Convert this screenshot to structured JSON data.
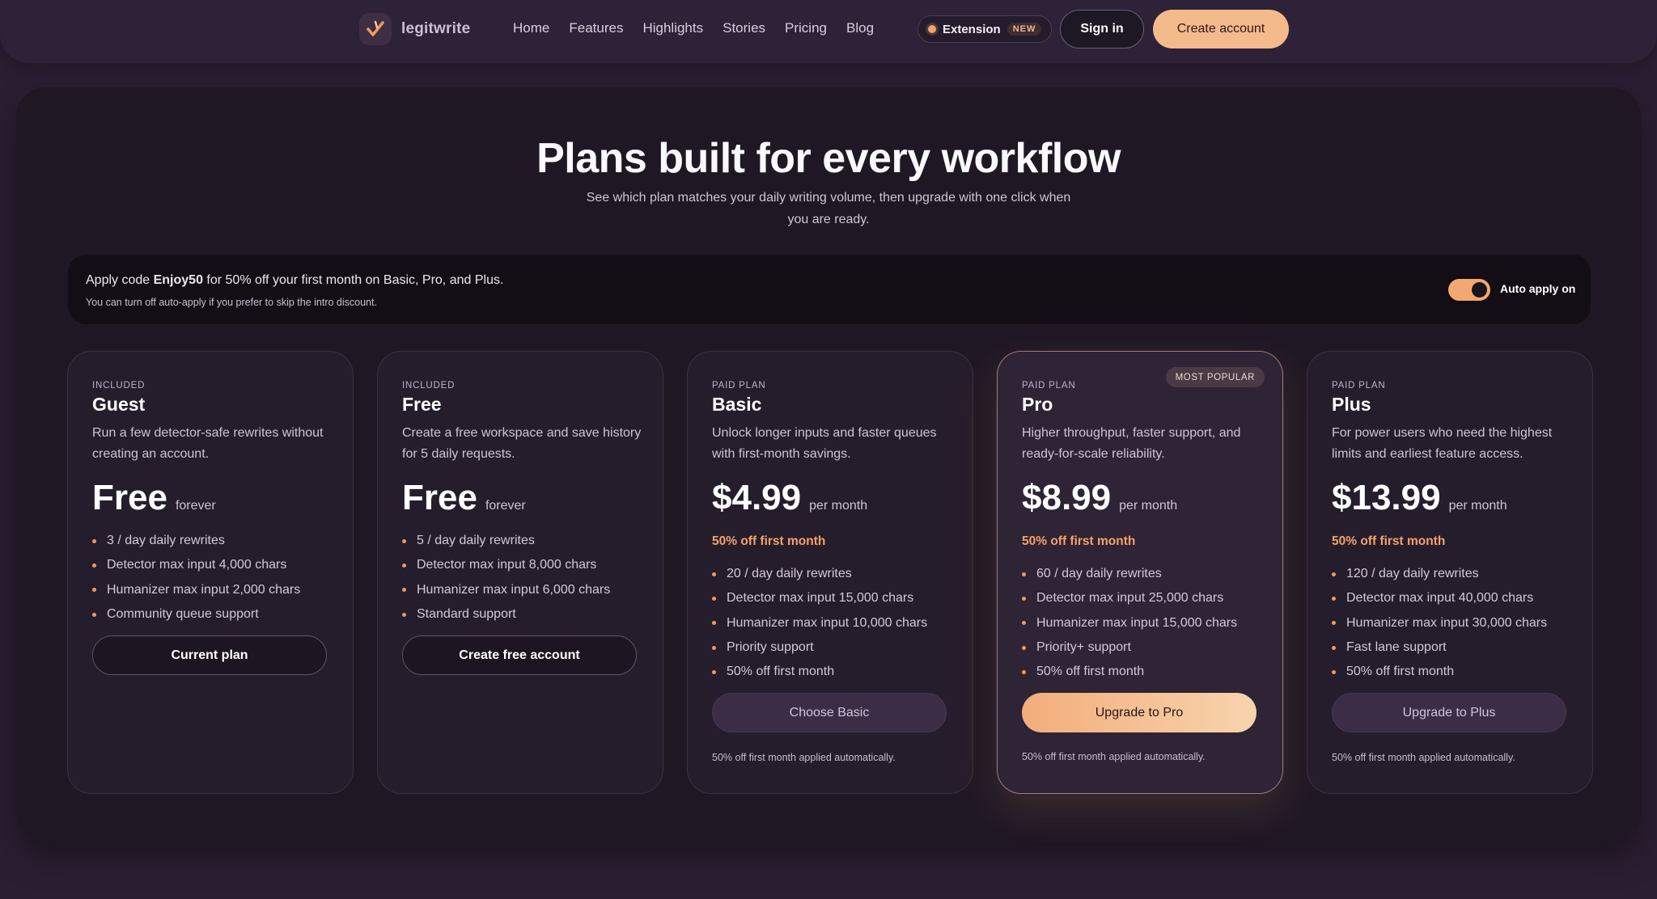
{
  "brand": {
    "name": "legitwrite"
  },
  "nav": {
    "links": [
      "Home",
      "Features",
      "Highlights",
      "Stories",
      "Pricing",
      "Blog"
    ],
    "extension_label": "Extension",
    "extension_badge": "NEW",
    "signin_label": "Sign in",
    "create_account_label": "Create account"
  },
  "hero": {
    "title": "Plans built for every workflow",
    "subtitle": "See which plan matches your daily writing volume, then upgrade with one click when you are ready."
  },
  "promo": {
    "prefix": "Apply code ",
    "code": "Enjoy50",
    "suffix": " for 50% off your first month on Basic, Pro, and Plus.",
    "sub": "You can turn off auto-apply if you prefer to skip the intro discount.",
    "toggle_label": "Auto apply on",
    "toggle_on": true
  },
  "plans": [
    {
      "eyebrow": "INCLUDED",
      "name": "Guest",
      "desc": "Run a few detector-safe rewrites without creating an account.",
      "price": "Free",
      "per": "forever",
      "features": [
        "3 / day daily rewrites",
        "Detector max input 4,000 chars",
        "Humanizer max input 2,000 chars",
        "Community queue support"
      ],
      "cta": "Current plan"
    },
    {
      "eyebrow": "INCLUDED",
      "name": "Free",
      "desc": "Create a free workspace and save history for 5 daily requests.",
      "price": "Free",
      "per": "forever",
      "features": [
        "5 / day daily rewrites",
        "Detector max input 8,000 chars",
        "Humanizer max input 6,000 chars",
        "Standard support"
      ],
      "cta": "Create free account"
    },
    {
      "eyebrow": "PAID PLAN",
      "name": "Basic",
      "desc": "Unlock longer inputs and faster queues with first-month savings.",
      "price": "$4.99",
      "per": "per month",
      "discount": "50% off first month",
      "features": [
        "20 / day daily rewrites",
        "Detector max input 15,000 chars",
        "Humanizer max input 10,000 chars",
        "Priority support",
        "50% off first month"
      ],
      "cta": "Choose Basic",
      "note": "50% off first month applied automatically."
    },
    {
      "eyebrow": "PAID PLAN",
      "name": "Pro",
      "badge": "MOST POPULAR",
      "desc": "Higher throughput, faster support, and ready-for-scale reliability.",
      "price": "$8.99",
      "per": "per month",
      "discount": "50% off first month",
      "features": [
        "60 / day daily rewrites",
        "Detector max input 25,000 chars",
        "Humanizer max input 15,000 chars",
        "Priority+ support",
        "50% off first month"
      ],
      "cta": "Upgrade to Pro",
      "note": "50% off first month applied automatically."
    },
    {
      "eyebrow": "PAID PLAN",
      "name": "Plus",
      "desc": "For power users who need the highest limits and earliest feature access.",
      "price": "$13.99",
      "per": "per month",
      "discount": "50% off first month",
      "features": [
        "120 / day daily rewrites",
        "Detector max input 40,000 chars",
        "Humanizer max input 30,000 chars",
        "Fast lane support",
        "50% off first month"
      ],
      "cta": "Upgrade to Plus",
      "note": "50% off first month applied automatically."
    }
  ],
  "colors": {
    "accent": "#f3a26a",
    "background": "#2a1f32",
    "panel": "#1f1824"
  }
}
